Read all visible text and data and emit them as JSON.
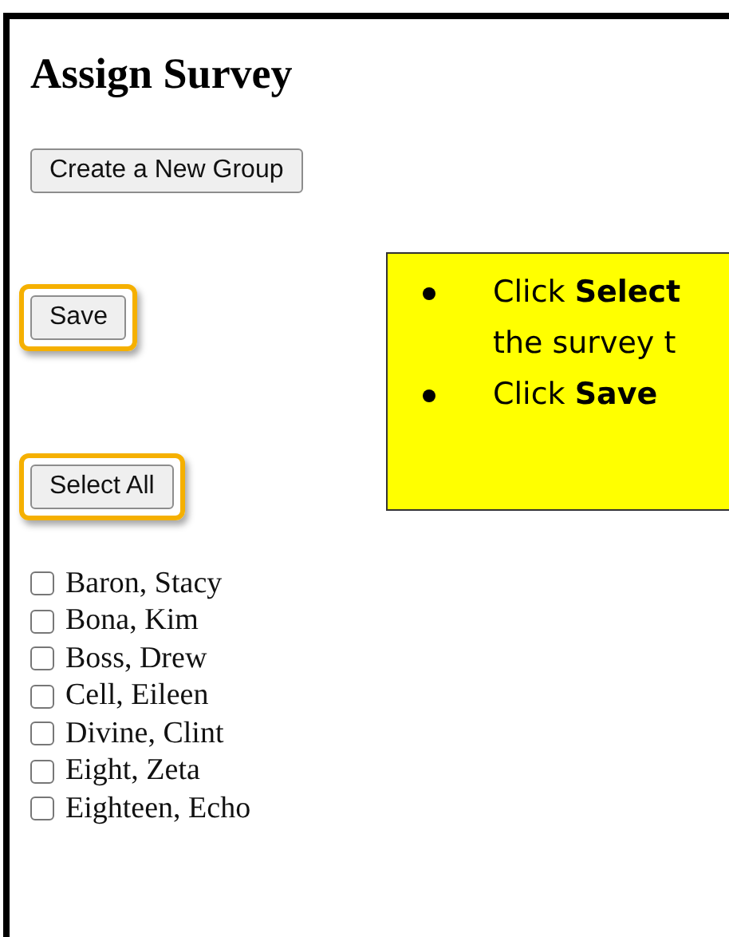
{
  "page": {
    "title": "Assign Survey"
  },
  "buttons": [
    {
      "label": "Create a New Group",
      "highlighted": false
    },
    {
      "label": "Save",
      "highlighted": true
    },
    {
      "label": "Select All",
      "highlighted": true
    }
  ],
  "callout": {
    "items": [
      {
        "lines": [
          "Click **Select**",
          "the survey t"
        ]
      },
      {
        "lines": [
          "Click **Save**"
        ]
      }
    ]
  },
  "people": [
    {
      "name": "Baron, Stacy",
      "checked": false
    },
    {
      "name": "Bona, Kim",
      "checked": false
    },
    {
      "name": "Boss, Drew",
      "checked": false
    },
    {
      "name": "Cell, Eileen",
      "checked": false
    },
    {
      "name": "Divine, Clint",
      "checked": false
    },
    {
      "name": "Eight, Zeta",
      "checked": false
    },
    {
      "name": "Eighteen, Echo",
      "checked": false
    }
  ]
}
